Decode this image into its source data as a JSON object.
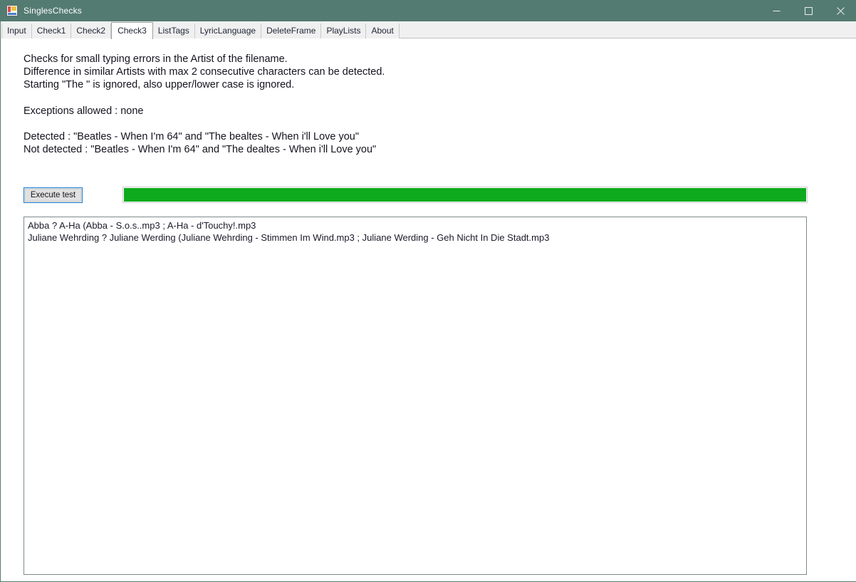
{
  "window": {
    "title": "SinglesChecks",
    "icon": "app-window-icon",
    "caption_buttons": [
      {
        "name": "minimize",
        "glyph": "minimize-icon"
      },
      {
        "name": "maximize",
        "glyph": "maximize-icon"
      },
      {
        "name": "close",
        "glyph": "close-icon"
      }
    ],
    "titlebar_color": "#547b71",
    "client_color": "#ffffff"
  },
  "tabs": [
    {
      "label": "Input",
      "selected": false
    },
    {
      "label": "Check1",
      "selected": false
    },
    {
      "label": "Check2",
      "selected": false
    },
    {
      "label": "Check3",
      "selected": true
    },
    {
      "label": "ListTags",
      "selected": false
    },
    {
      "label": "LyricLanguage",
      "selected": false
    },
    {
      "label": "DeleteFrame",
      "selected": false
    },
    {
      "label": "PlayLists",
      "selected": false
    },
    {
      "label": "About",
      "selected": false
    }
  ],
  "description": {
    "line1": "Checks for small typing errors in the Artist of the filename.",
    "line2": "Difference in similar Artists with max 2 consecutive characters can be detected.",
    "line3": "Starting \"The \" is ignored, also upper/lower case is ignored.",
    "line4": "Exceptions allowed : none",
    "line5": "Detected : \"Beatles - When I'm 64\" and \"The bealtes - When i'll Love you\"",
    "line6": "Not detected : \"Beatles - When I'm 64\" and \"The dealtes - When i'll Love you\""
  },
  "actions": {
    "execute_label": "Execute test"
  },
  "progress": {
    "percent": 100,
    "fill_color": "#0eaa1e"
  },
  "results": {
    "lines": [
      "Abba ? A-Ha (Abba - S.o.s..mp3 ; A-Ha - d'Touchy!.mp3",
      "Juliane Wehrding ? Juliane Werding (Juliane Wehrding - Stimmen Im Wind.mp3 ; Juliane Werding - Geh Nicht In Die Stadt.mp3"
    ]
  }
}
